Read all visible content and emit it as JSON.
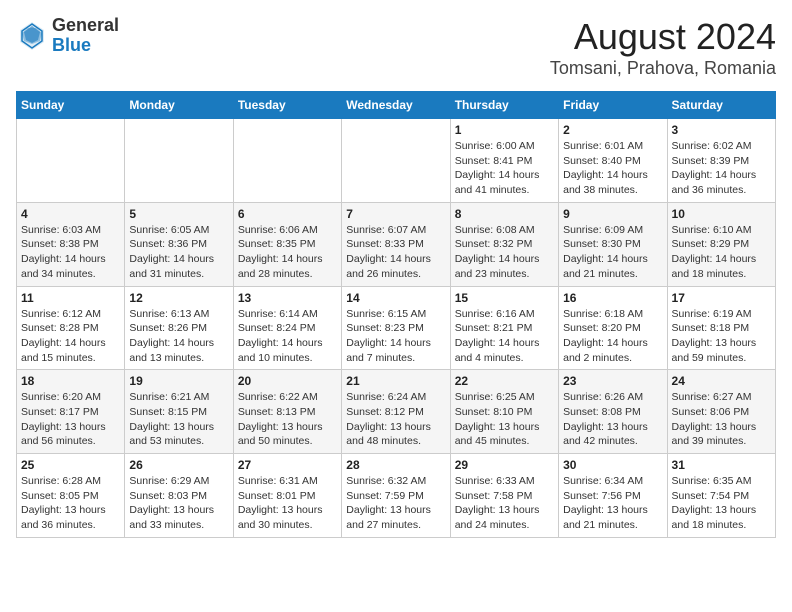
{
  "logo": {
    "general": "General",
    "blue": "Blue"
  },
  "title": "August 2024",
  "subtitle": "Tomsani, Prahova, Romania",
  "days_of_week": [
    "Sunday",
    "Monday",
    "Tuesday",
    "Wednesday",
    "Thursday",
    "Friday",
    "Saturday"
  ],
  "weeks": [
    [
      {
        "day": "",
        "info": ""
      },
      {
        "day": "",
        "info": ""
      },
      {
        "day": "",
        "info": ""
      },
      {
        "day": "",
        "info": ""
      },
      {
        "day": "1",
        "info": "Sunrise: 6:00 AM\nSunset: 8:41 PM\nDaylight: 14 hours and 41 minutes."
      },
      {
        "day": "2",
        "info": "Sunrise: 6:01 AM\nSunset: 8:40 PM\nDaylight: 14 hours and 38 minutes."
      },
      {
        "day": "3",
        "info": "Sunrise: 6:02 AM\nSunset: 8:39 PM\nDaylight: 14 hours and 36 minutes."
      }
    ],
    [
      {
        "day": "4",
        "info": "Sunrise: 6:03 AM\nSunset: 8:38 PM\nDaylight: 14 hours and 34 minutes."
      },
      {
        "day": "5",
        "info": "Sunrise: 6:05 AM\nSunset: 8:36 PM\nDaylight: 14 hours and 31 minutes."
      },
      {
        "day": "6",
        "info": "Sunrise: 6:06 AM\nSunset: 8:35 PM\nDaylight: 14 hours and 28 minutes."
      },
      {
        "day": "7",
        "info": "Sunrise: 6:07 AM\nSunset: 8:33 PM\nDaylight: 14 hours and 26 minutes."
      },
      {
        "day": "8",
        "info": "Sunrise: 6:08 AM\nSunset: 8:32 PM\nDaylight: 14 hours and 23 minutes."
      },
      {
        "day": "9",
        "info": "Sunrise: 6:09 AM\nSunset: 8:30 PM\nDaylight: 14 hours and 21 minutes."
      },
      {
        "day": "10",
        "info": "Sunrise: 6:10 AM\nSunset: 8:29 PM\nDaylight: 14 hours and 18 minutes."
      }
    ],
    [
      {
        "day": "11",
        "info": "Sunrise: 6:12 AM\nSunset: 8:28 PM\nDaylight: 14 hours and 15 minutes."
      },
      {
        "day": "12",
        "info": "Sunrise: 6:13 AM\nSunset: 8:26 PM\nDaylight: 14 hours and 13 minutes."
      },
      {
        "day": "13",
        "info": "Sunrise: 6:14 AM\nSunset: 8:24 PM\nDaylight: 14 hours and 10 minutes."
      },
      {
        "day": "14",
        "info": "Sunrise: 6:15 AM\nSunset: 8:23 PM\nDaylight: 14 hours and 7 minutes."
      },
      {
        "day": "15",
        "info": "Sunrise: 6:16 AM\nSunset: 8:21 PM\nDaylight: 14 hours and 4 minutes."
      },
      {
        "day": "16",
        "info": "Sunrise: 6:18 AM\nSunset: 8:20 PM\nDaylight: 14 hours and 2 minutes."
      },
      {
        "day": "17",
        "info": "Sunrise: 6:19 AM\nSunset: 8:18 PM\nDaylight: 13 hours and 59 minutes."
      }
    ],
    [
      {
        "day": "18",
        "info": "Sunrise: 6:20 AM\nSunset: 8:17 PM\nDaylight: 13 hours and 56 minutes."
      },
      {
        "day": "19",
        "info": "Sunrise: 6:21 AM\nSunset: 8:15 PM\nDaylight: 13 hours and 53 minutes."
      },
      {
        "day": "20",
        "info": "Sunrise: 6:22 AM\nSunset: 8:13 PM\nDaylight: 13 hours and 50 minutes."
      },
      {
        "day": "21",
        "info": "Sunrise: 6:24 AM\nSunset: 8:12 PM\nDaylight: 13 hours and 48 minutes."
      },
      {
        "day": "22",
        "info": "Sunrise: 6:25 AM\nSunset: 8:10 PM\nDaylight: 13 hours and 45 minutes."
      },
      {
        "day": "23",
        "info": "Sunrise: 6:26 AM\nSunset: 8:08 PM\nDaylight: 13 hours and 42 minutes."
      },
      {
        "day": "24",
        "info": "Sunrise: 6:27 AM\nSunset: 8:06 PM\nDaylight: 13 hours and 39 minutes."
      }
    ],
    [
      {
        "day": "25",
        "info": "Sunrise: 6:28 AM\nSunset: 8:05 PM\nDaylight: 13 hours and 36 minutes."
      },
      {
        "day": "26",
        "info": "Sunrise: 6:29 AM\nSunset: 8:03 PM\nDaylight: 13 hours and 33 minutes."
      },
      {
        "day": "27",
        "info": "Sunrise: 6:31 AM\nSunset: 8:01 PM\nDaylight: 13 hours and 30 minutes."
      },
      {
        "day": "28",
        "info": "Sunrise: 6:32 AM\nSunset: 7:59 PM\nDaylight: 13 hours and 27 minutes."
      },
      {
        "day": "29",
        "info": "Sunrise: 6:33 AM\nSunset: 7:58 PM\nDaylight: 13 hours and 24 minutes."
      },
      {
        "day": "30",
        "info": "Sunrise: 6:34 AM\nSunset: 7:56 PM\nDaylight: 13 hours and 21 minutes."
      },
      {
        "day": "31",
        "info": "Sunrise: 6:35 AM\nSunset: 7:54 PM\nDaylight: 13 hours and 18 minutes."
      }
    ]
  ]
}
